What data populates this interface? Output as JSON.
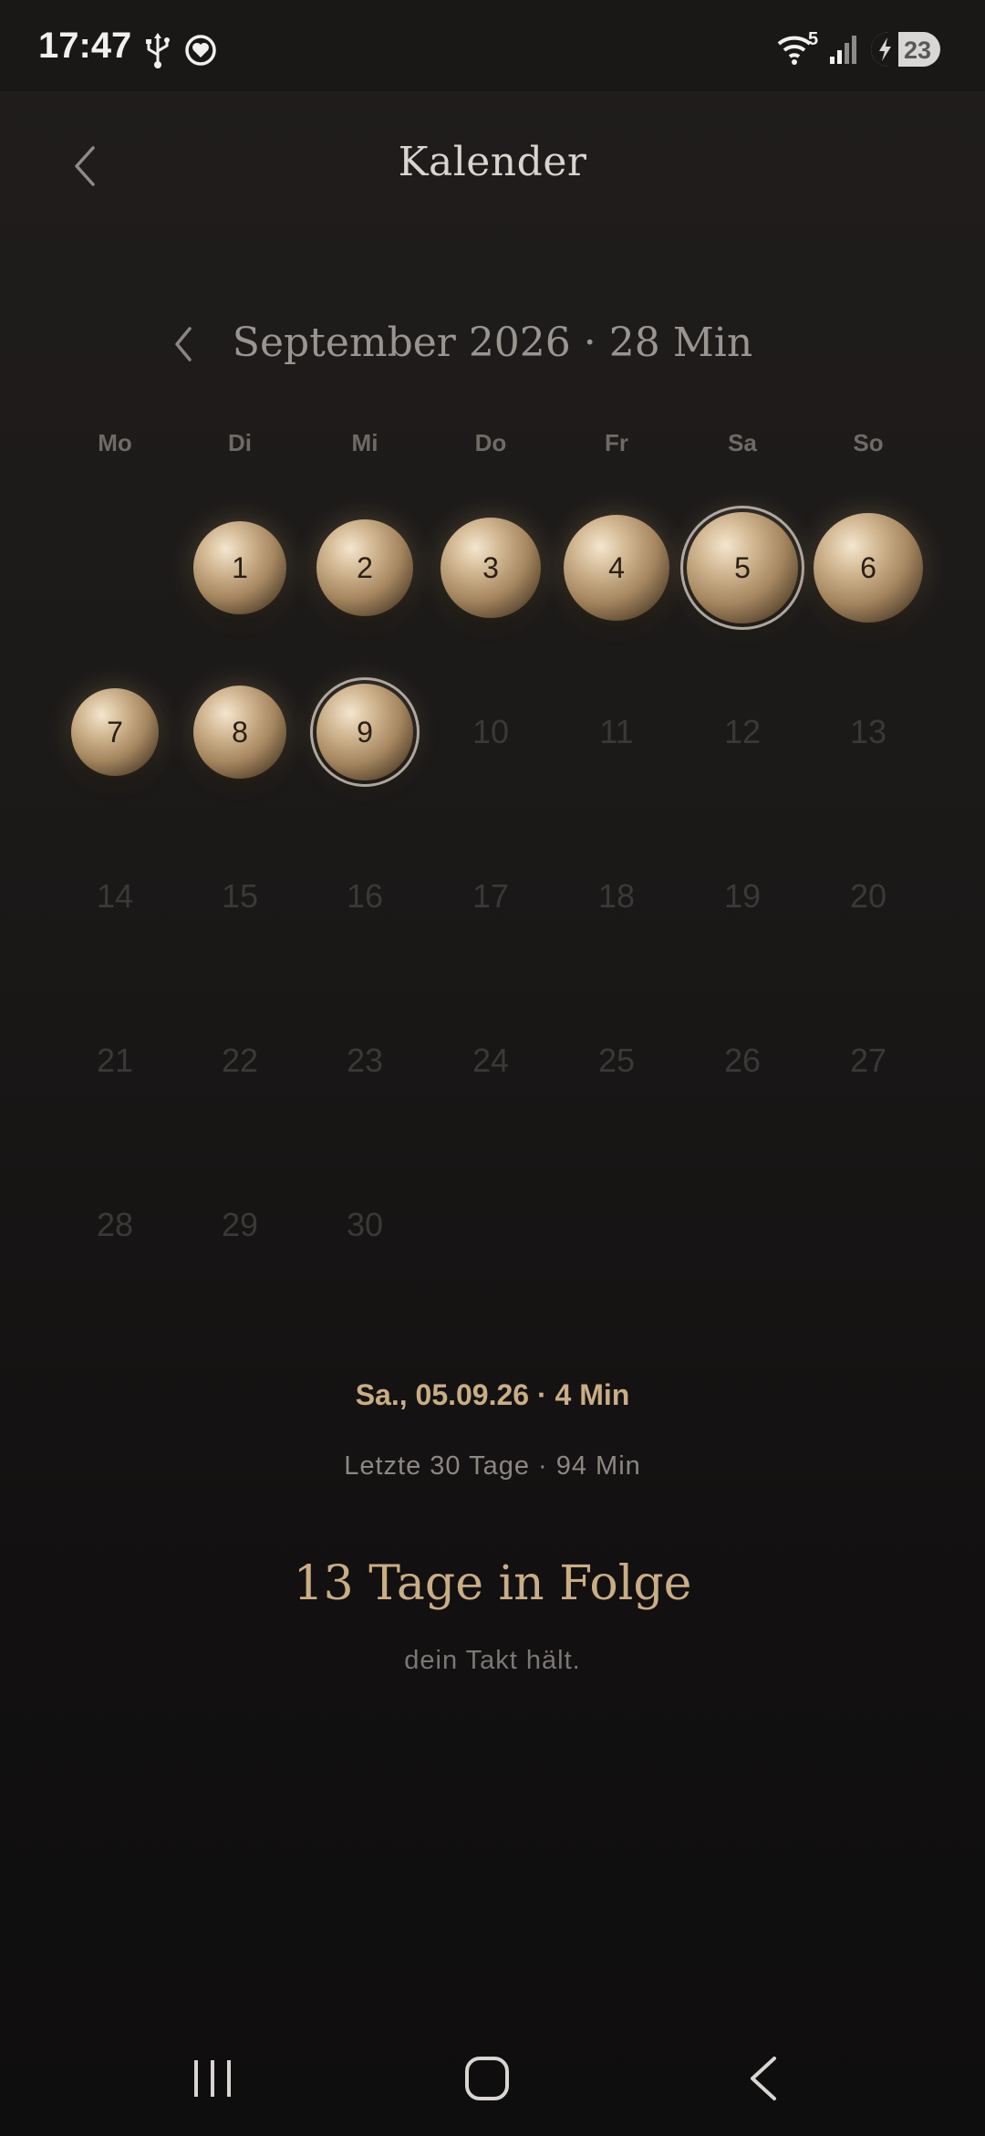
{
  "status_bar": {
    "time": "17:47",
    "battery": "23",
    "wifi_badge": "5",
    "icons": [
      "usb-icon",
      "heart-shield-icon",
      "wifi-icon",
      "signal-icon",
      "battery-charging-icon"
    ]
  },
  "header": {
    "title": "Kalender",
    "back_icon": "chevron-left-icon"
  },
  "calendar": {
    "month_label": "September 2026 · 28 Min",
    "weekdays": [
      "Mo",
      "Di",
      "Mi",
      "Do",
      "Fr",
      "Sa",
      "So"
    ],
    "days": [
      {
        "day": "1",
        "active": true,
        "selected": false
      },
      {
        "day": "2",
        "active": true,
        "selected": false
      },
      {
        "day": "3",
        "active": true,
        "selected": false
      },
      {
        "day": "4",
        "active": true,
        "selected": false
      },
      {
        "day": "5",
        "active": true,
        "selected": true
      },
      {
        "day": "6",
        "active": true,
        "selected": false
      },
      {
        "day": "7",
        "active": true,
        "selected": false
      },
      {
        "day": "8",
        "active": true,
        "selected": false
      },
      {
        "day": "9",
        "active": true,
        "selected": false,
        "today": true
      },
      {
        "day": "10",
        "active": false
      },
      {
        "day": "11",
        "active": false
      },
      {
        "day": "12",
        "active": false
      },
      {
        "day": "13",
        "active": false
      },
      {
        "day": "14",
        "active": false
      },
      {
        "day": "15",
        "active": false
      },
      {
        "day": "16",
        "active": false
      },
      {
        "day": "17",
        "active": false
      },
      {
        "day": "18",
        "active": false
      },
      {
        "day": "19",
        "active": false
      },
      {
        "day": "20",
        "active": false
      },
      {
        "day": "21",
        "active": false
      },
      {
        "day": "22",
        "active": false
      },
      {
        "day": "23",
        "active": false
      },
      {
        "day": "24",
        "active": false
      },
      {
        "day": "25",
        "active": false
      },
      {
        "day": "26",
        "active": false
      },
      {
        "day": "27",
        "active": false
      },
      {
        "day": "28",
        "active": false
      },
      {
        "day": "29",
        "active": false
      },
      {
        "day": "30",
        "active": false
      }
    ]
  },
  "summary": {
    "selected_day": "Sa., 05.09.26 · 4 Min",
    "last_30": "Letzte 30 Tage · 94 Min",
    "streak": "13 Tage in Folge",
    "streak_sub": "dein Takt hält."
  },
  "nav_bar": {
    "icons": [
      "recent-apps-icon",
      "home-icon",
      "back-icon"
    ]
  },
  "colors": {
    "accent_gold": "#c9ad85",
    "background": "#1b1918",
    "inactive_day": "#3b3836"
  }
}
